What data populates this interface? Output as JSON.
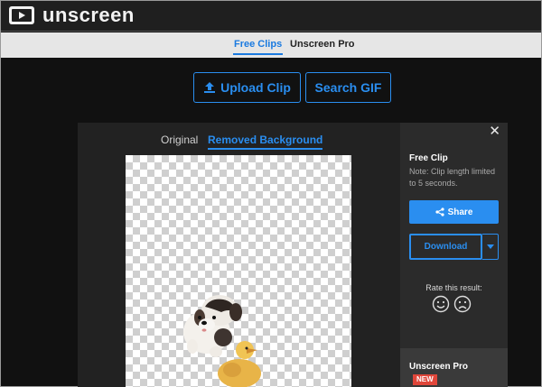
{
  "header": {
    "brand": "unscreen",
    "logo_icon": "play-screen-icon"
  },
  "subnav": {
    "tabs": [
      {
        "label": "Free Clips",
        "active": true
      },
      {
        "label": "Unscreen Pro",
        "active": false
      }
    ]
  },
  "actions": {
    "upload_label": "Upload Clip",
    "search_label": "Search GIF"
  },
  "viewer": {
    "tabs": [
      {
        "label": "Original",
        "active": false
      },
      {
        "label": "Removed Background",
        "active": true
      }
    ]
  },
  "sidebar": {
    "close_glyph": "✕",
    "title": "Free Clip",
    "note": "Note: Clip length limited to 5 seconds.",
    "share_label": "Share",
    "download_label": "Download",
    "rate_label": "Rate this result:",
    "pro_title": "Unscreen Pro",
    "pro_badge": "NEW"
  },
  "colors": {
    "accent": "#2a8ef0",
    "badge": "#e0463a"
  }
}
